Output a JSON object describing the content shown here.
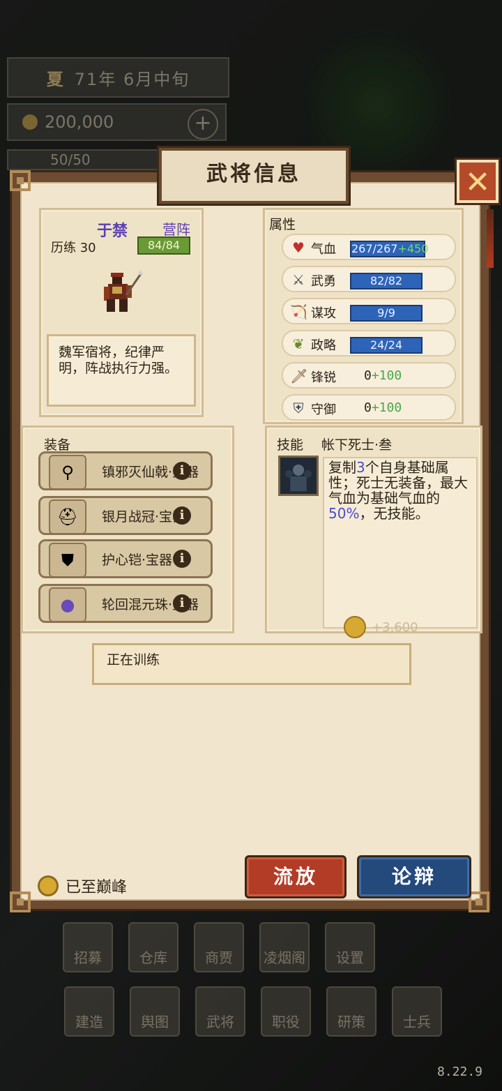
{
  "background": {
    "season": "夏",
    "date": "71年 6月中旬",
    "gold": "200,000",
    "troops": "50/50",
    "nav_row1": [
      "招募",
      "仓库",
      "商贾",
      "凌烟阁",
      "设置"
    ],
    "nav_row2": [
      "建造",
      "舆图",
      "武将",
      "职役",
      "研策",
      "士兵"
    ],
    "version": "8.22.9"
  },
  "dialog": {
    "title": "武将信息",
    "close_label": "✕"
  },
  "hero": {
    "name": "于禁",
    "role": "营阵",
    "exp_label": "历练 30",
    "hp_badge": "84/84",
    "description": "魏军宿将，纪律严明，阵战执行力强。"
  },
  "attributes": {
    "title": "属性",
    "rows": [
      {
        "icon": "heart-icon",
        "name": "气血",
        "value": "267/267",
        "bonus": "+450"
      },
      {
        "icon": "swords-icon",
        "name": "武勇",
        "value": "82/82"
      },
      {
        "icon": "bow-icon",
        "name": "谋攻",
        "value": "9/9"
      },
      {
        "icon": "wheat-icon",
        "name": "政略",
        "value": "24/24"
      },
      {
        "icon": "sword-icon",
        "name": "锋锐",
        "value": "0",
        "bonus": "+100"
      },
      {
        "icon": "shield-icon",
        "name": "守御",
        "value": "0",
        "bonus": "+100"
      }
    ]
  },
  "equipment": {
    "title": "装备",
    "items": [
      {
        "icon": "halberd-icon",
        "name": "镇邪灭仙戟·宝器"
      },
      {
        "icon": "helmet-icon",
        "name": "银月战冠·宝器"
      },
      {
        "icon": "armor-icon",
        "name": "护心铠·宝器"
      },
      {
        "icon": "orb-icon",
        "name": "轮回混元珠·宝器"
      }
    ],
    "info_glyph": "i"
  },
  "skill": {
    "label": "技能",
    "name": "帐下死士·叁",
    "desc_1": "复制",
    "desc_num1": "3",
    "desc_2": "个自身基础属性；死士无装备，最大气血为基础气血的",
    "desc_num2": "50%",
    "desc_3": "，无技能。",
    "cost": "+3,600"
  },
  "status": {
    "training": "正在训练"
  },
  "footer": {
    "peak_label": "已至巅峰",
    "exile_button": "流放",
    "debate_button": "论辩"
  },
  "colors": {
    "panel_wood": "#6c4b31",
    "parchment": "#f1e5cd",
    "exile_red": "#b33c26",
    "debate_blue": "#244a7c",
    "stat_bar_blue": "#2e64b8",
    "hero_name_purple": "#5b3fb3"
  }
}
